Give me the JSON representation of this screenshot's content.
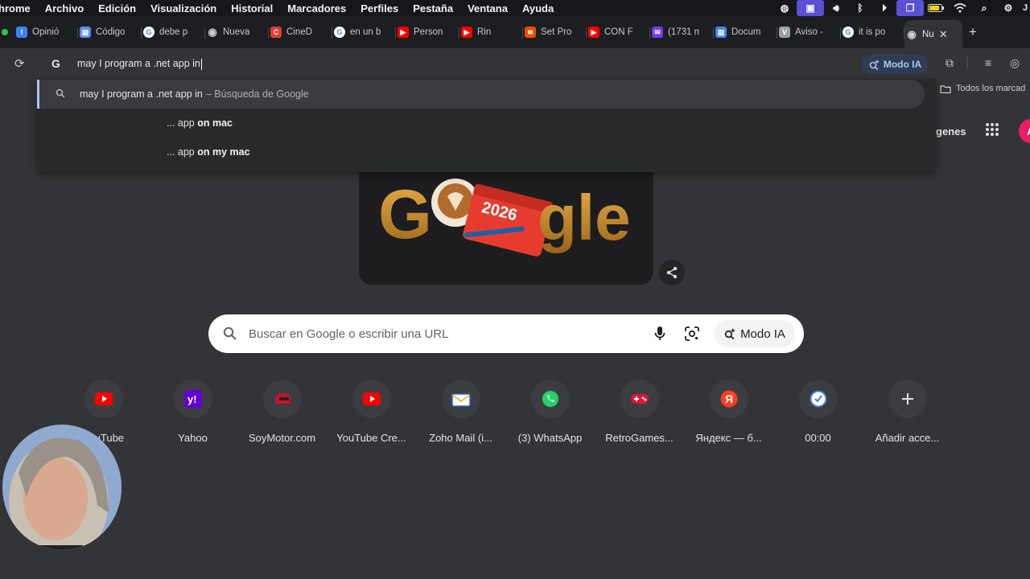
{
  "menubar": {
    "app_name": "hrome",
    "items": [
      "Archivo",
      "Edición",
      "Visualización",
      "Historial",
      "Marcadores",
      "Perfiles",
      "Pestaña",
      "Ventana",
      "Ayuda"
    ],
    "tray_last": "J"
  },
  "tabs": [
    {
      "title": "Opinió",
      "icon": "l-icon",
      "color": "#3b82f6"
    },
    {
      "title": "Código",
      "icon": "doc-icon",
      "color": "#5b8def"
    },
    {
      "title": "debe p",
      "icon": "google-icon",
      "color": "#ffffff"
    },
    {
      "title": "Nueva",
      "icon": "chrome-icon",
      "color": "#cfcfcf"
    },
    {
      "title": "CineD",
      "icon": "cined-icon",
      "color": "#e53935"
    },
    {
      "title": "en un b",
      "icon": "google-icon",
      "color": "#ffffff"
    },
    {
      "title": "Person",
      "icon": "youtube-icon",
      "color": "#ff0000"
    },
    {
      "title": "Rin",
      "icon": "youtube-icon",
      "color": "#ff0000"
    },
    {
      "title": "Set Pro",
      "icon": "layers-icon",
      "color": "#e65100"
    },
    {
      "title": "CON F",
      "icon": "youtube-icon",
      "color": "#ff0000"
    },
    {
      "title": "(1731 n",
      "icon": "mail-icon",
      "color": "#6a3de8"
    },
    {
      "title": "Docum",
      "icon": "docs-icon",
      "color": "#4285f4"
    },
    {
      "title": "Aviso -",
      "icon": "v-icon",
      "color": "#9aa0a6"
    },
    {
      "title": "it is po",
      "icon": "google-icon",
      "color": "#ffffff"
    },
    {
      "title": "Nu",
      "icon": "chrome-icon",
      "color": "#cfcfcf",
      "active": true
    }
  ],
  "omnibox": {
    "value": "may I program a .net app in",
    "modo_ia": "Modo IA"
  },
  "bookmarks": {
    "label": "Todos los marcad"
  },
  "suggestions": [
    {
      "text": "may I program a .net app in",
      "desc": "– Búsqueda de Google"
    },
    {
      "prefix": "... app ",
      "bold": "on mac"
    },
    {
      "prefix": "... app ",
      "bold": "on my mac"
    }
  ],
  "header": {
    "images": "genes",
    "avatar": "A"
  },
  "search": {
    "placeholder": "Buscar en Google o escribir una URL",
    "modo_ia": "Modo IA"
  },
  "doodle": {
    "year": "2026"
  },
  "shortcuts": [
    {
      "label": "YouTube",
      "icon": "youtube-icon"
    },
    {
      "label": "Yahoo",
      "icon": "yahoo-icon"
    },
    {
      "label": "SoyMotor.com",
      "icon": "helmet-icon"
    },
    {
      "label": "YouTube Cre...",
      "icon": "youtube-icon"
    },
    {
      "label": "Zoho Mail (i...",
      "icon": "zoho-mail-icon"
    },
    {
      "label": "(3) WhatsApp",
      "icon": "whatsapp-icon"
    },
    {
      "label": "RetroGames...",
      "icon": "gamepad-icon"
    },
    {
      "label": "Яндекс — б...",
      "icon": "yandex-icon"
    },
    {
      "label": "00:00",
      "icon": "clock-icon"
    },
    {
      "label": "Añadir acce...",
      "icon": "plus-icon"
    }
  ]
}
